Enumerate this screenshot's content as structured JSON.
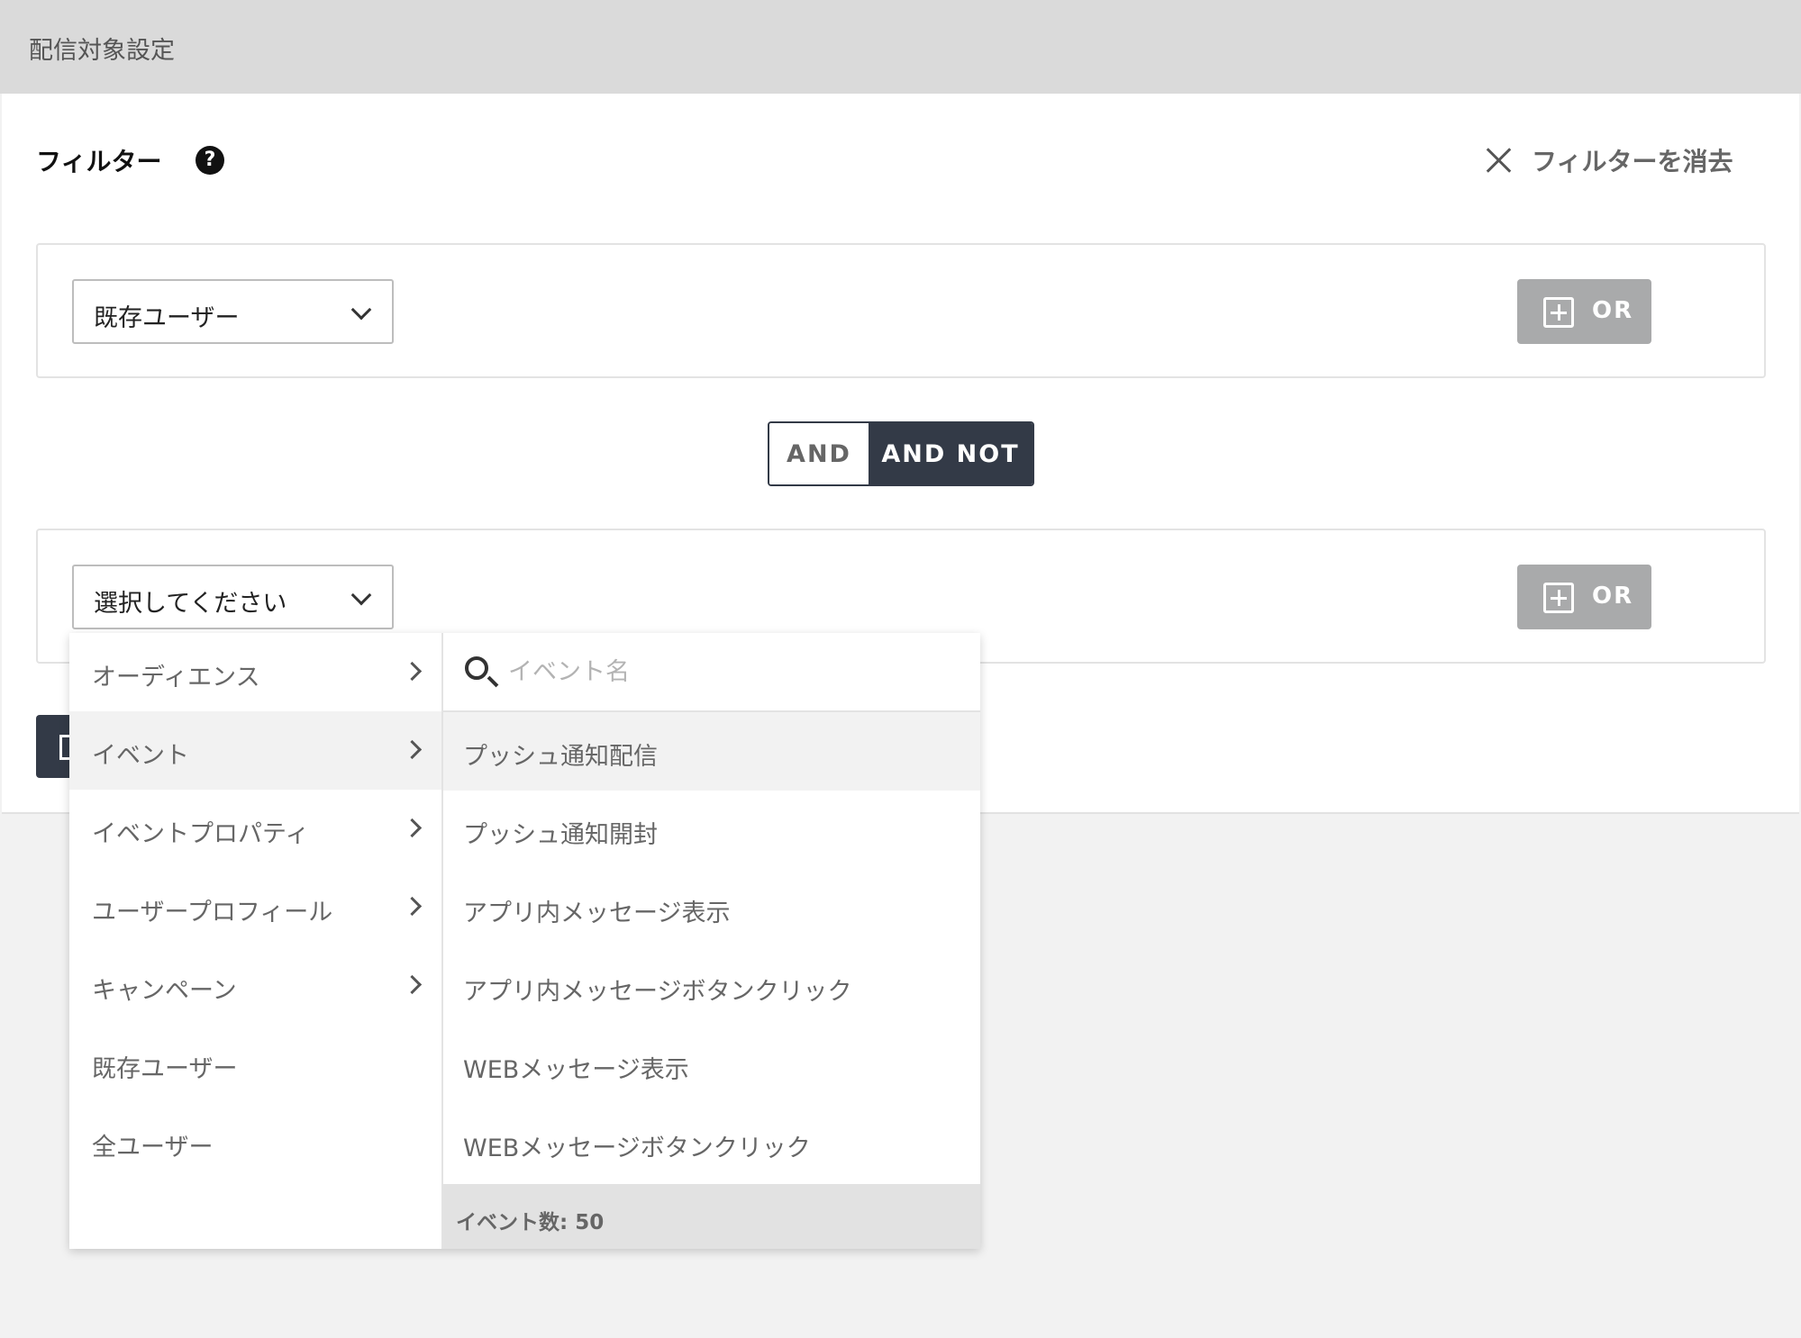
{
  "header": {
    "title": "配信対象設定"
  },
  "filter": {
    "label": "フィルター",
    "help_icon": "?",
    "clear_label": "フィルターを消去"
  },
  "groups": [
    {
      "select_value": "既存ユーザー",
      "or_label": "OR"
    },
    {
      "select_value": "選択してください",
      "or_label": "OR"
    }
  ],
  "combinator": {
    "and_label": "AND",
    "and_not_label": "AND NOT",
    "selected": "AND NOT"
  },
  "dropdown": {
    "categories": [
      {
        "label": "オーディエンス",
        "has_submenu": true
      },
      {
        "label": "イベント",
        "has_submenu": true,
        "active": true
      },
      {
        "label": "イベントプロパティ",
        "has_submenu": true
      },
      {
        "label": "ユーザープロフィール",
        "has_submenu": true
      },
      {
        "label": "キャンペーン",
        "has_submenu": true
      },
      {
        "label": "既存ユーザー",
        "has_submenu": false
      },
      {
        "label": "全ユーザー",
        "has_submenu": false
      }
    ],
    "search": {
      "placeholder": "イベント名",
      "value": ""
    },
    "events": [
      {
        "label": "プッシュ通知配信",
        "active": true
      },
      {
        "label": "プッシュ通知開封"
      },
      {
        "label": "アプリ内メッセージ表示"
      },
      {
        "label": "アプリ内メッセージボタンクリック"
      },
      {
        "label": "WEBメッセージ表示"
      },
      {
        "label": "WEBメッセージボタンクリック"
      }
    ],
    "footer": "イベント数: 50"
  },
  "colors": {
    "dark": "#333a47",
    "or_button": "#a9aaab",
    "header_bg": "#dadada",
    "page_bg": "#f2f2f2"
  },
  "icons": [
    "help-icon",
    "close-icon",
    "chevron-down-icon",
    "plus-square-icon",
    "chevron-right-icon",
    "search-icon"
  ]
}
